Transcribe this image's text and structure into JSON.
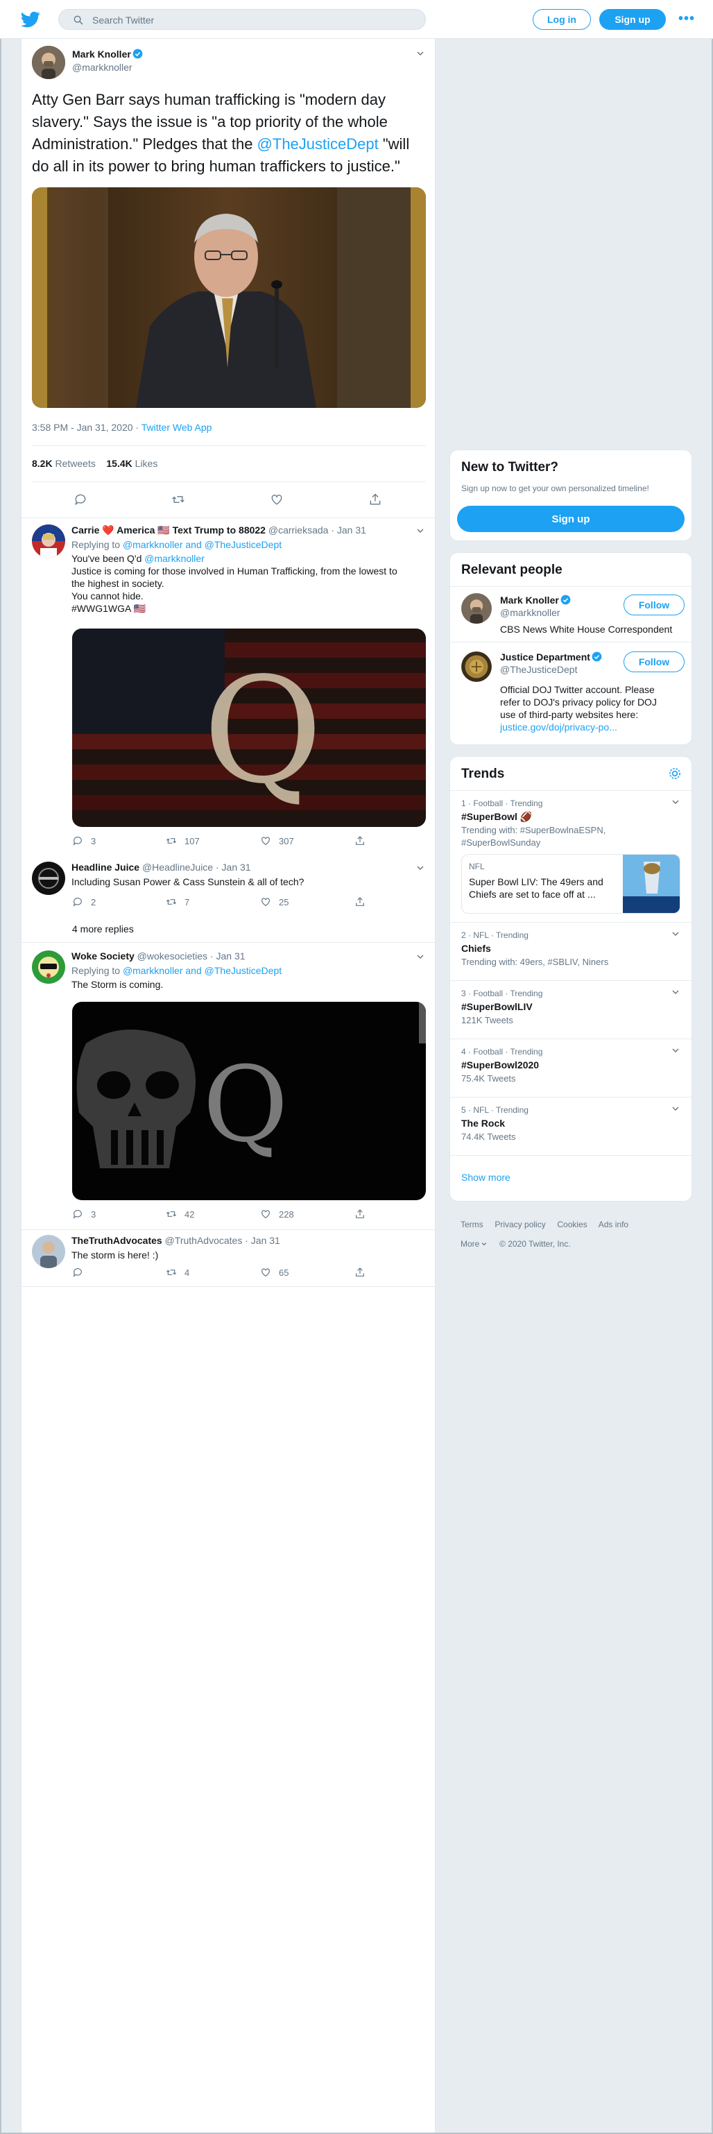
{
  "header": {
    "search_placeholder": "Search Twitter",
    "login_label": "Log in",
    "signup_label": "Sign up",
    "more_label": "•••"
  },
  "colors": {
    "accent": "#1da1f2",
    "text": "#14171a",
    "muted": "#657786",
    "background": "#e6ecf0",
    "like": "#e0245e"
  },
  "tweet": {
    "author_name": "Mark Knoller",
    "author_handle": "@markknoller",
    "text_before": "Atty Gen Barr says human trafficking is \"modern day slavery.\" Says the issue is \"a top priority of the whole Administration.\" Pledges that the ",
    "mention": "@TheJusticeDept",
    "text_after": " \"will do all in its power to bring human traffickers to justice.\"",
    "timestamp": "3:58 PM - Jan 31, 2020",
    "source": "Twitter Web App",
    "retweets_count": "8.2K",
    "retweets_label": "Retweets",
    "likes_count": "15.4K",
    "likes_label": "Likes"
  },
  "replies": [
    {
      "name": "Carrie ❤️ America 🇺🇸 Text Trump to 88022",
      "handle": "@carrieksada",
      "date": "Jan 31",
      "replying_prefix": "Replying to ",
      "replying_to": "@markknoller and @TheJusticeDept",
      "line1_prefix": "You've been Q'd ",
      "line1_mention": "@markknoller",
      "line2": "Justice is coming for those involved in Human Trafficking, from the lowest to",
      "line3": "the highest in society.",
      "line4": "You cannot hide.",
      "hashtag": "#WWG1WGA 🇺🇸",
      "media_letter": "Q",
      "reply_count": "3",
      "retweet_count": "107",
      "like_count": "307"
    },
    {
      "name": "Headline Juice",
      "handle": "@HeadlineJuice",
      "date": "Jan 31",
      "text": "Including Susan Power & Cass Sunstein & all of tech?",
      "reply_count": "2",
      "retweet_count": "7",
      "like_count": "25"
    },
    {
      "more_replies": "4 more replies"
    },
    {
      "name": "Woke Society",
      "handle": "@wokesocieties",
      "date": "Jan 31",
      "replying_prefix": "Replying to ",
      "replying_to": "@markknoller and @TheJusticeDept",
      "text": "The Storm is coming.",
      "media_letter": "Q",
      "reply_count": "3",
      "retweet_count": "42",
      "like_count": "228"
    },
    {
      "name": "TheTruthAdvocates",
      "handle": "@TruthAdvocates",
      "date": "Jan 31",
      "text": "The storm is here! :)",
      "retweet_count": "4",
      "like_count": "65"
    }
  ],
  "new_to_twitter": {
    "title": "New to Twitter?",
    "subtitle": "Sign up now to get your own personalized timeline!",
    "signup_label": "Sign up"
  },
  "relevant_people": {
    "title": "Relevant people",
    "people": [
      {
        "name": "Mark Knoller",
        "handle": "@markknoller",
        "bio": "CBS News White House Correspondent",
        "follow_label": "Follow"
      },
      {
        "name": "Justice Department",
        "handle": "@TheJusticeDept",
        "bio1": "Official DOJ Twitter account. Please",
        "bio2": "refer to DOJ's privacy policy for DOJ",
        "bio3": "use of third-party websites here:",
        "bio_link": "justice.gov/doj/privacy-po...",
        "follow_label": "Follow"
      }
    ]
  },
  "trends": {
    "title": "Trends",
    "items": [
      {
        "meta": "1 · Football · Trending",
        "name": "#SuperBowl 🏈",
        "sub1": "Trending with: #SuperBowlnaESPN,",
        "sub2": "#SuperBowlSunday",
        "news_label": "NFL",
        "news_text1": "Super Bowl LIV: The 49ers and",
        "news_text2": "Chiefs are set to face off at ..."
      },
      {
        "meta": "2 · NFL · Trending",
        "name": "Chiefs",
        "sub1": "Trending with: 49ers, #SBLIV, Niners"
      },
      {
        "meta": "3 · Football · Trending",
        "name": "#SuperBowlLIV",
        "sub1": "121K Tweets"
      },
      {
        "meta": "4 · Football · Trending",
        "name": "#SuperBowl2020",
        "sub1": "75.4K Tweets"
      },
      {
        "meta": "5 · NFL · Trending",
        "name": "The Rock",
        "sub1": "74.4K Tweets"
      }
    ],
    "show_more": "Show more"
  },
  "footer": {
    "links": [
      "Terms",
      "Privacy policy",
      "Cookies",
      "Ads info"
    ],
    "more_label": "More",
    "copyright": "© 2020 Twitter, Inc."
  }
}
